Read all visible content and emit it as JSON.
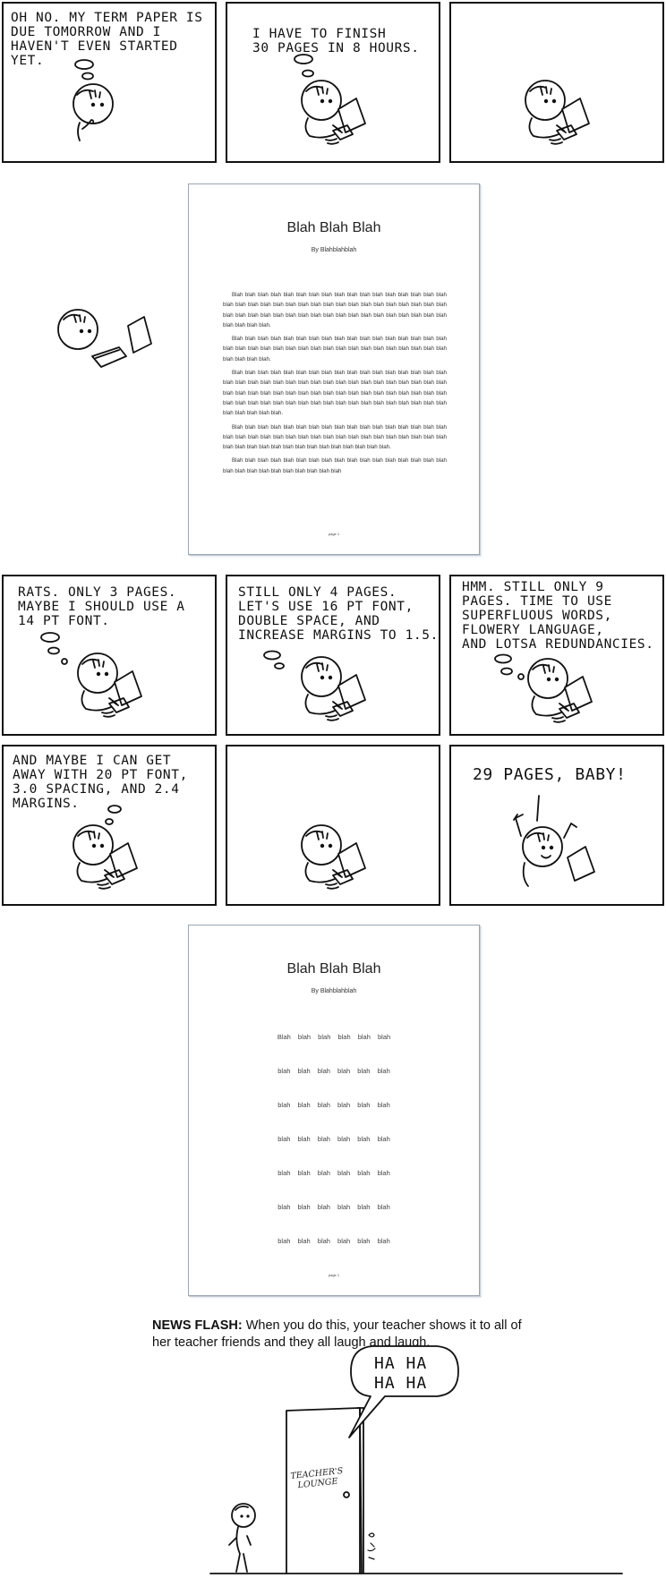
{
  "row1": {
    "panel1_caption": "OH NO. MY TERM PAPER IS\nDUE TOMORROW AND I\nHAVEN'T EVEN STARTED\nYET.",
    "panel2_caption": "I HAVE TO FINISH\n30 PAGES IN 8 HOURS."
  },
  "doc1": {
    "title": "Blah Blah Blah",
    "author": "By Blahblahblah",
    "paragraphs": [
      "Blah blah blah blah blah blah blah blah blah blah blah blah blah blah blah blah blah blah blah blah blah blah blah blah blah blah blah blah blah blah blah blah blah blah blah blah blah blah blah blah blah blah blah blah blah blah blah blah blah blah blah blah blah blah blah blah blah.",
      "Blah blah blah blah blah blah blah blah blah blah blah blah blah blah blah blah blah blah blah blah blah blah blah blah blah blah blah blah blah blah blah blah blah blah blah blah blah blah blah.",
      "Blah blah blah blah blah blah blah blah blah blah blah blah blah blah blah blah blah blah blah blah blah blah blah blah blah blah blah blah blah blah blah blah blah blah blah blah blah blah blah blah blah blah blah blah blah blah blah blah blah blah blah blah blah blah blah blah blah blah blah blah blah blah blah blah blah blah blah blah blah blah blah blah blah blah blah blah.",
      "Blah blah blah blah blah blah blah blah blah blah blah blah blah blah blah blah blah blah blah blah blah blah blah blah blah blah blah blah blah blah blah blah blah blah blah blah blah blah blah blah blah blah blah blah blah blah blah blah blah.",
      "Blah blah blah blah blah blah blah blah blah blah blah blah blah blah blah blah blah blah blah blah blah blah blah blah blah blah blah"
    ],
    "page_number": "page 1"
  },
  "row3": {
    "panel1_caption": "RATS. ONLY 3 PAGES.\nMAYBE I SHOULD USE A\n14 PT FONT.",
    "panel2_caption": "STILL ONLY  4  PAGES.\nLET'S USE 16 PT FONT,\nDOUBLE SPACE, AND\nINCREASE MARGINS TO 1.5.",
    "panel3_caption": "HMM. STILL ONLY 9\nPAGES. TIME TO USE\nSUPERFLUOUS WORDS,\nFLOWERY LANGUAGE,\nAND LOTSA REDUNDANCIES."
  },
  "row4": {
    "panel1_caption": "AND MAYBE I CAN GET\nAWAY WITH 20 PT FONT,\n3.0 SPACING, AND 2.4\nMARGINS.",
    "panel3_caption": "29 PAGES, BABY!"
  },
  "doc2": {
    "title": "Blah Blah Blah",
    "author": "By Blahblahblah",
    "lines": [
      "Blah blah blah blah blah blah",
      "blah blah blah blah blah blah",
      "blah blah blah blah blah blah",
      "blah blah blah blah blah blah",
      "blah blah blah blah blah blah",
      "blah blah blah blah blah blah",
      "blah blah blah blah blah blah"
    ],
    "page_number": "page 1"
  },
  "news": {
    "lead": "NEWS FLASH:",
    "text": " When you do this, your teacher shows it to all of her teacher friends and they all laugh and laugh."
  },
  "final": {
    "bubble": "HA HA\n  HA HA",
    "door_sign": "TEACHER'S\nLOUNGE"
  }
}
